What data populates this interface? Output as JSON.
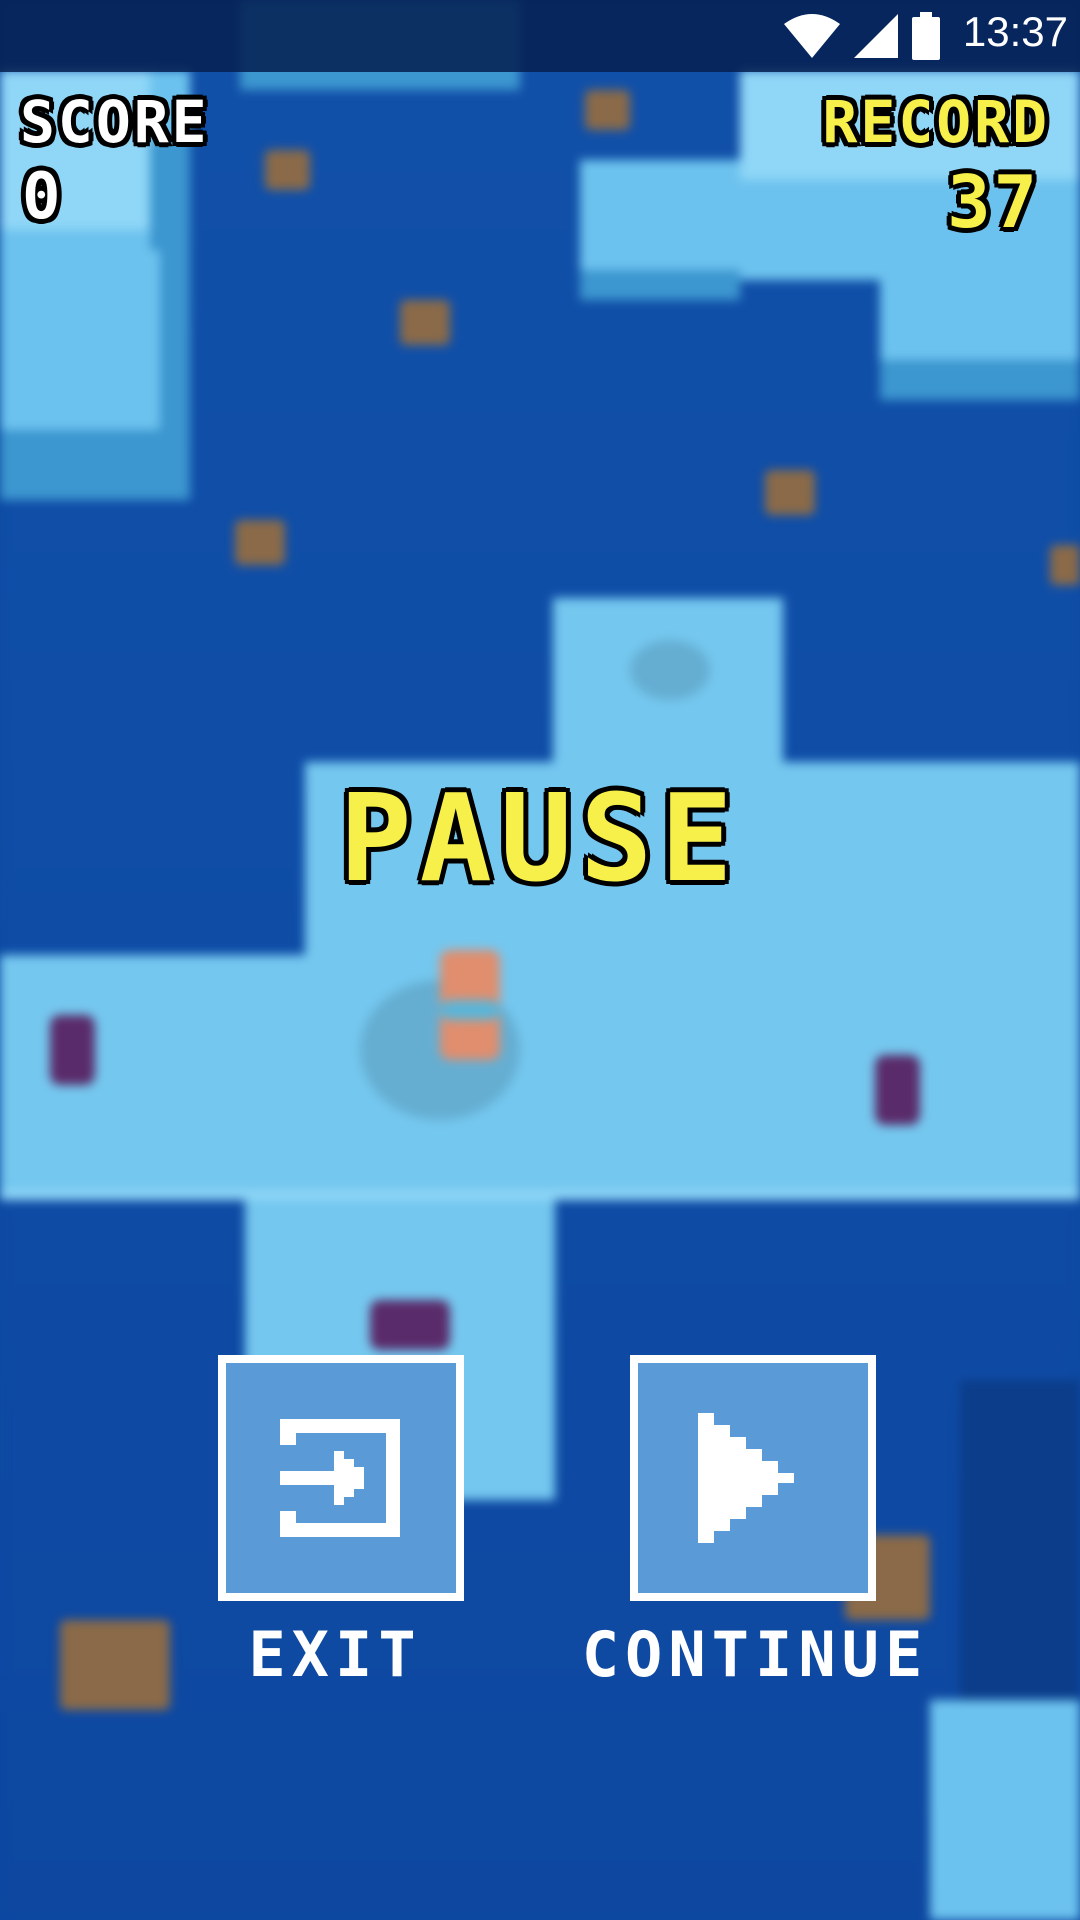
{
  "status_bar": {
    "time": "13:37",
    "icons": [
      "wifi-icon",
      "cell-signal-icon",
      "battery-icon"
    ]
  },
  "hud": {
    "score_label": "SCORE",
    "score_value": "0",
    "record_label": "RECORD",
    "record_value": "37"
  },
  "pause_menu": {
    "title": "PAUSE",
    "exit_label": "EXIT",
    "exit_icon": "exit-door-icon",
    "continue_label": "CONTINUE",
    "continue_icon": "play-icon"
  },
  "colors": {
    "accent_yellow": "#f7f04a",
    "water": "#0d4aa3",
    "ice": "#6cc2ee",
    "button_fill": "#5a9bd7",
    "button_border": "#ffffff"
  }
}
